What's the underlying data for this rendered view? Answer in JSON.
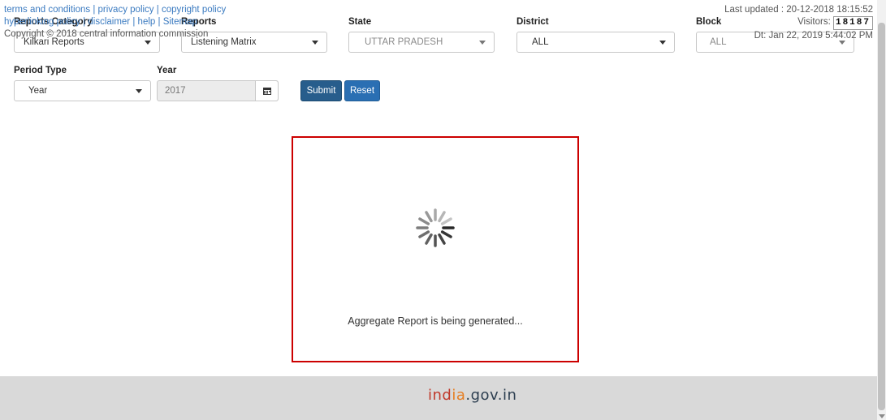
{
  "filters": {
    "reports_category": {
      "label": "Reports Category",
      "value": "Kilkari Reports"
    },
    "reports": {
      "label": "Reports",
      "value": "Listening Matrix"
    },
    "state": {
      "label": "State",
      "value": "UTTAR PRADESH"
    },
    "district": {
      "label": "District",
      "value": "ALL"
    },
    "block": {
      "label": "Block",
      "value": "ALL"
    },
    "period_type": {
      "label": "Period Type",
      "value": "Year"
    },
    "year": {
      "label": "Year",
      "value": "2017"
    }
  },
  "buttons": {
    "submit": "Submit",
    "reset": "Reset"
  },
  "loading": {
    "message": "Aggregate Report is being generated..."
  },
  "footer": {
    "links_row1": [
      "terms and conditions",
      "privacy policy",
      "copyright policy"
    ],
    "links_row2": [
      "hyperlinking policy",
      "disclaimer",
      "help",
      "Sitemap"
    ],
    "separator": "|",
    "copyright": "Copyright © 2018 central information commission",
    "logo": {
      "part1": "ind",
      "part2": "ia",
      "part3": ".gov.in"
    },
    "last_updated": "Last updated : 20-12-2018 18:15:52",
    "visitors_label": "Visitors:",
    "visitors_count": "18187",
    "datetime": "Dt: Jan 22, 2019 5:44:02 PM"
  },
  "icons": {
    "calendar": "calendar-icon",
    "caret": "caret-down-icon",
    "spinner": "spinner-icon"
  },
  "colors": {
    "submit": "#275d8c",
    "reset": "#2a6fb3",
    "loading_border": "#cc0000",
    "link": "#3a7ac0"
  }
}
